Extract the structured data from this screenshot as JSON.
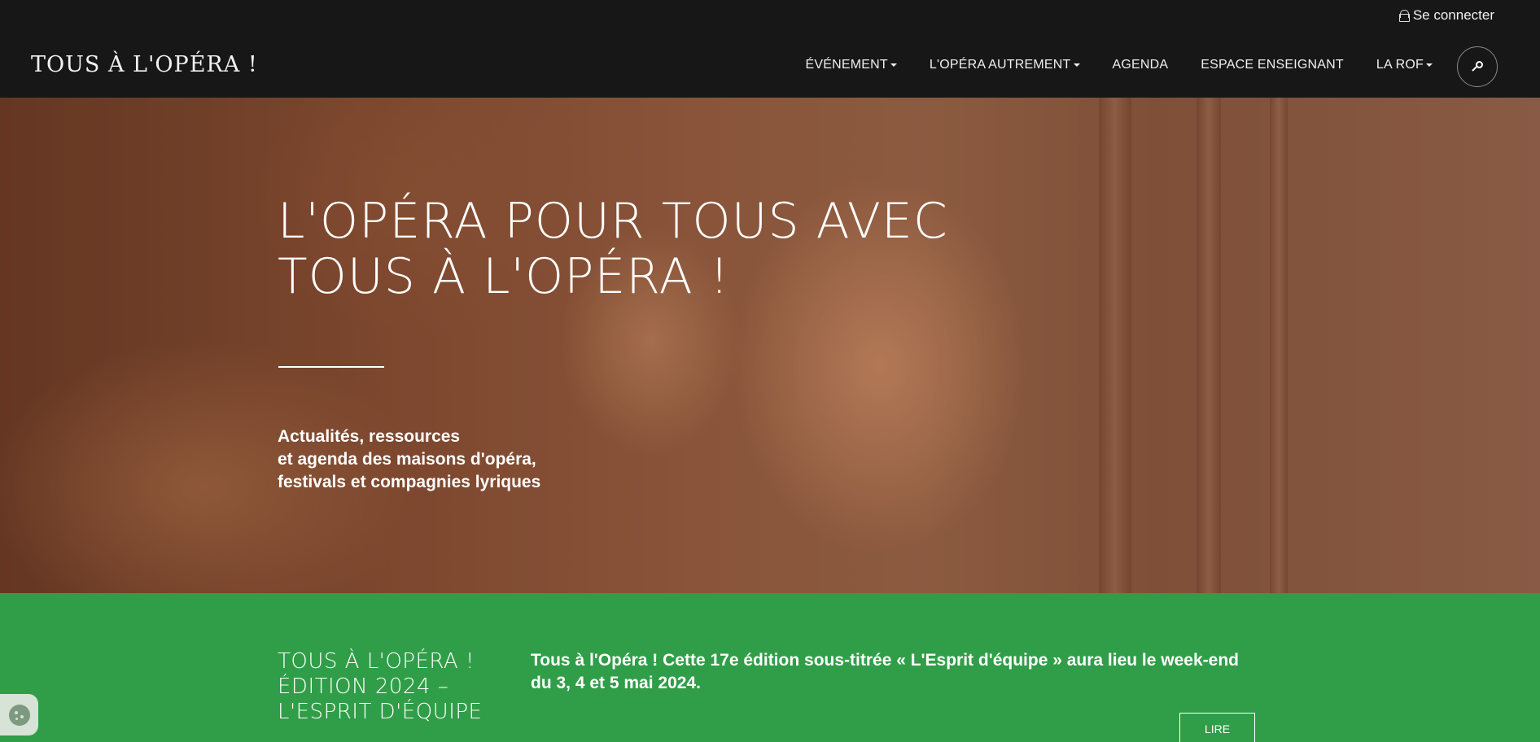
{
  "topbar": {
    "login_label": "Se connecter"
  },
  "navbar": {
    "brand": "TOUS À L'OPÉRA !",
    "items": [
      {
        "label": "ÉVÉNEMENT",
        "dropdown": true
      },
      {
        "label": "L'OPÉRA AUTREMENT",
        "dropdown": true
      },
      {
        "label": "AGENDA",
        "dropdown": false
      },
      {
        "label": "ESPACE ENSEIGNANT",
        "dropdown": false
      },
      {
        "label": "LA ROF",
        "dropdown": true
      }
    ],
    "search_icon": "search-icon"
  },
  "hero": {
    "title_line1": "L'OPÉRA POUR TOUS AVEC",
    "title_line2": "TOUS À L'OPÉRA !",
    "subtitle_line1": "Actualités, ressources",
    "subtitle_line2": "et agenda des maisons d'opéra,",
    "subtitle_line3": "festivals et compagnies lyriques"
  },
  "feature": {
    "title_line1": "TOUS À L'OPÉRA !",
    "title_line2": "ÉDITION 2024 –",
    "title_line3": "L'ESPRIT D'ÉQUIPE",
    "text": "Tous à l'Opéra ! Cette 17e édition sous-titrée « L'Esprit d'équipe » aura lieu le week-end du 3, 4 et 5 mai 2024.",
    "button_label": "LIRE"
  },
  "colors": {
    "header_bg": "#171717",
    "band_green": "#309e48",
    "text": "#ffffff"
  },
  "cookie_widget": {
    "icon": "cookie-icon"
  }
}
